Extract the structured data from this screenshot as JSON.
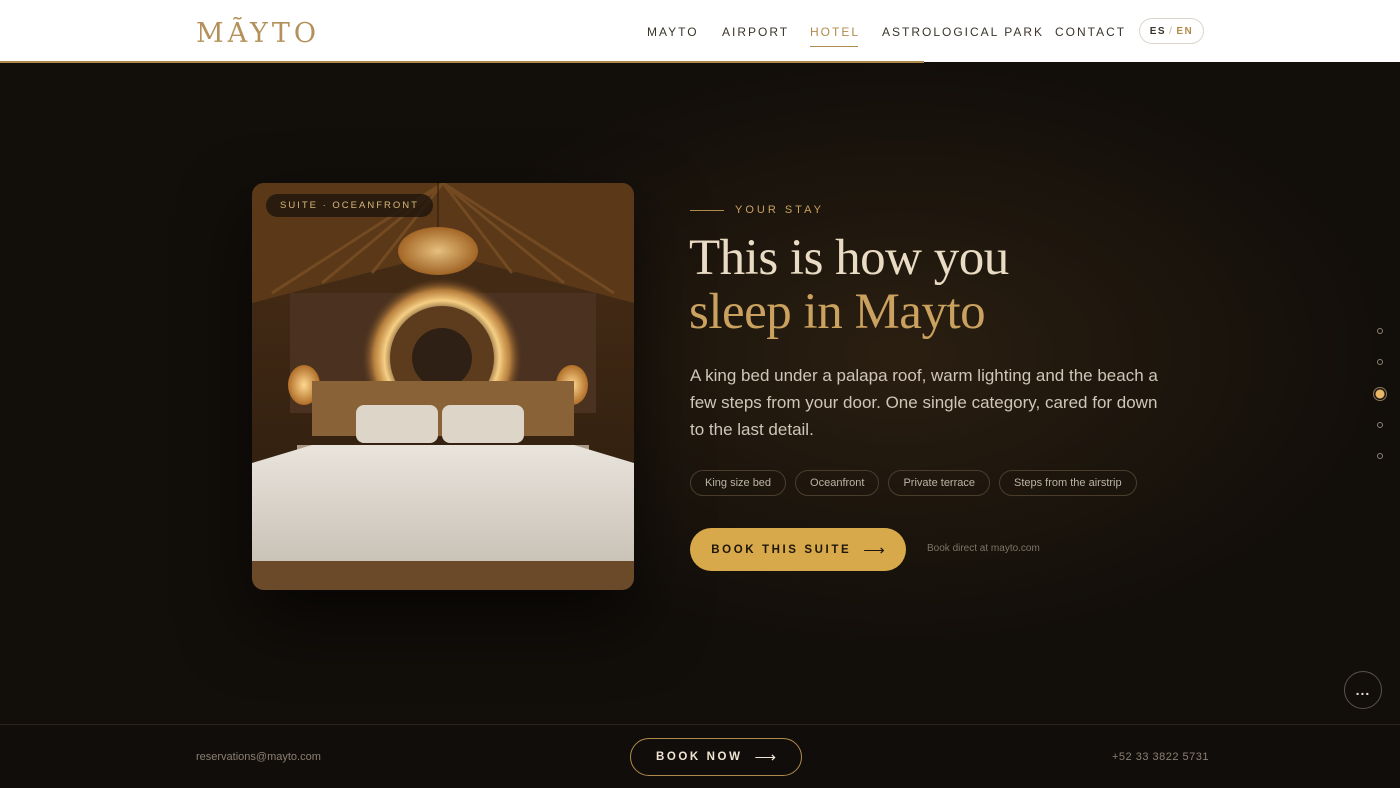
{
  "header": {
    "logo": "MÃYTO",
    "nav": [
      {
        "label": "MAYTO",
        "active": false
      },
      {
        "label": "AIRPORT",
        "active": false
      },
      {
        "label": "HOTEL",
        "active": true
      },
      {
        "label": "ASTROLOGICAL PARK",
        "active": false
      },
      {
        "label": "CONTACT",
        "active": false
      }
    ],
    "lang": {
      "es": "ES",
      "sep": "/",
      "en": "EN",
      "active": "EN"
    },
    "scroll_progress": 0.66
  },
  "hero": {
    "room_tag": "SUITE · OCEANFRONT",
    "eyebrow": "YOUR STAY",
    "title_line1": "This is how you",
    "title_line2": "sleep in Mayto",
    "description": "A king bed under a palapa roof, warm lighting and the beach a few steps from your door. One single category, cared for down to the last detail.",
    "features": [
      "King size bed",
      "Oceanfront",
      "Private terrace",
      "Steps from the airstrip"
    ],
    "cta_label": "BOOK THIS SUITE",
    "cta_icon": "arrow-right-icon",
    "cta_note": "Book direct at mayto.com"
  },
  "section_dots": {
    "count": 5,
    "active_index": 2
  },
  "more_button": {
    "label": "...",
    "icon": "more-icon"
  },
  "footer": {
    "email": "reservations@mayto.com",
    "book_label": "BOOK NOW",
    "phone": "+52 33 3822 5731"
  },
  "colors": {
    "accent": "#b08b4c",
    "cta": "#d7a94b",
    "background": "#120e0a",
    "header_bg": "#ffffff"
  }
}
